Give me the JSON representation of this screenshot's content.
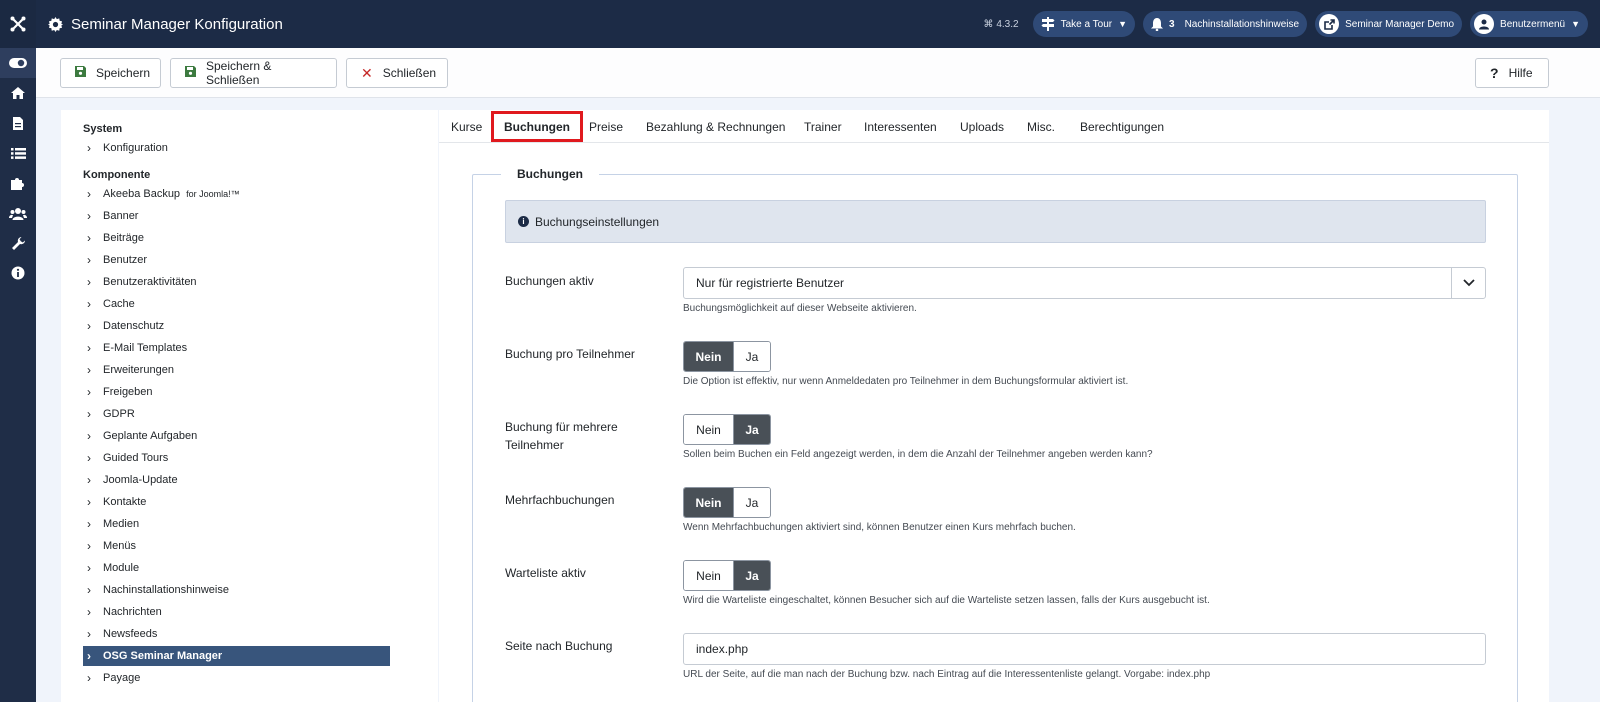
{
  "app": {
    "title": "Seminar Manager Konfiguration",
    "version": "4.3.2"
  },
  "header": {
    "take_tour": "Take a Tour",
    "notif_count": "3",
    "notif_label": "Nachinstallationshinweise",
    "site_label": "Seminar Manager Demo",
    "user_menu": "Benutzermenü"
  },
  "toolbar": {
    "save_label": "Speichern",
    "save_close_label": "Speichern & Schließen",
    "close_label": "Schließen",
    "help_label": "Hilfe"
  },
  "sidebar": {
    "group_system": "System",
    "system_items": [
      "Konfiguration"
    ],
    "group_component": "Komponente",
    "component_items": [
      {
        "label": "Akeeba Backup",
        "sub": "for Joomla!™"
      },
      {
        "label": "Banner"
      },
      {
        "label": "Beiträge"
      },
      {
        "label": "Benutzer"
      },
      {
        "label": "Benutzeraktivitäten"
      },
      {
        "label": "Cache"
      },
      {
        "label": "Datenschutz"
      },
      {
        "label": "E-Mail Templates"
      },
      {
        "label": "Erweiterungen"
      },
      {
        "label": "Freigeben"
      },
      {
        "label": "GDPR"
      },
      {
        "label": "Geplante Aufgaben"
      },
      {
        "label": "Guided Tours"
      },
      {
        "label": "Joomla-Update"
      },
      {
        "label": "Kontakte"
      },
      {
        "label": "Medien"
      },
      {
        "label": "Menüs"
      },
      {
        "label": "Module"
      },
      {
        "label": "Nachinstallationshinweise"
      },
      {
        "label": "Nachrichten"
      },
      {
        "label": "Newsfeeds"
      },
      {
        "label": "OSG Seminar Manager"
      },
      {
        "label": "Payage"
      }
    ]
  },
  "tabs": [
    "Kurse",
    "Buchungen",
    "Preise",
    "Bezahlung & Rechnungen",
    "Trainer",
    "Interessenten",
    "Uploads",
    "Misc.",
    "Berechtigungen"
  ],
  "form": {
    "legend": "Buchungen",
    "info": "Buchungseinstellungen",
    "booking_active": {
      "label": "Buchungen aktiv",
      "value": "Nur für registrierte Benutzer",
      "help": "Buchungsmöglichkeit auf dieser Webseite aktivieren."
    },
    "per_participant": {
      "label": "Buchung pro Teilnehmer",
      "no": "Nein",
      "yes": "Ja",
      "selected": "Nein",
      "help": "Die Option ist effektiv, nur wenn Anmeldedaten pro Teilnehmer in dem Buchungsformular aktiviert ist."
    },
    "multiple_participants": {
      "label": "Buchung für mehrere Teilnehmer",
      "no": "Nein",
      "yes": "Ja",
      "selected": "Ja",
      "help": "Sollen beim Buchen ein Feld angezeigt werden, in dem die Anzahl der Teilnehmer angeben werden kann?"
    },
    "multi_booking": {
      "label": "Mehrfachbuchungen",
      "no": "Nein",
      "yes": "Ja",
      "selected": "Nein",
      "help": "Wenn Mehrfachbuchungen aktiviert sind, können Benutzer einen Kurs mehrfach buchen."
    },
    "waitlist": {
      "label": "Warteliste aktiv",
      "no": "Nein",
      "yes": "Ja",
      "selected": "Ja",
      "help": "Wird die Warteliste eingeschaltet, können Besucher sich auf die Warteliste setzen lassen, falls der Kurs ausgebucht ist."
    },
    "after_booking": {
      "label": "Seite nach Buchung",
      "value": "index.php",
      "help": "URL der Seite, auf die man nach der Buchung bzw. nach Eintrag auf die Interessentenliste gelangt. Vorgabe: index.php"
    }
  }
}
